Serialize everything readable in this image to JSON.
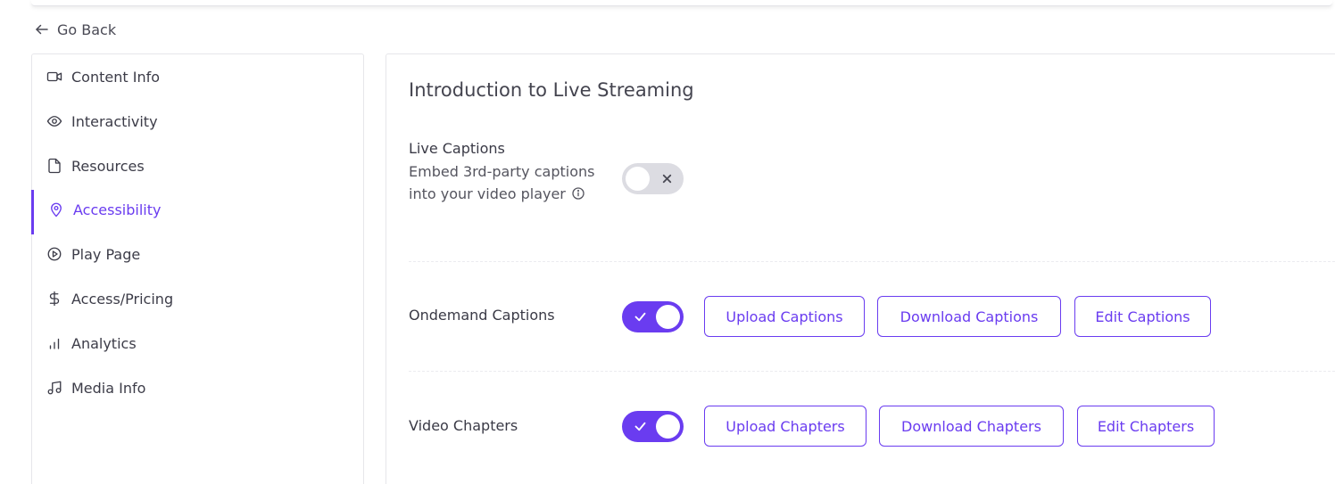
{
  "nav": {
    "go_back": "Go Back"
  },
  "sidebar": {
    "items": [
      {
        "label": "Content Info",
        "icon": "video-camera-icon"
      },
      {
        "label": "Interactivity",
        "icon": "eye-icon"
      },
      {
        "label": "Resources",
        "icon": "file-icon"
      },
      {
        "label": "Accessibility",
        "icon": "map-pin-icon",
        "active": true
      },
      {
        "label": "Play Page",
        "icon": "play-circle-icon"
      },
      {
        "label": "Access/Pricing",
        "icon": "dollar-icon"
      },
      {
        "label": "Analytics",
        "icon": "bar-chart-icon"
      },
      {
        "label": "Media Info",
        "icon": "music-icon"
      }
    ]
  },
  "main": {
    "title": "Introduction to Live Streaming",
    "live_captions": {
      "label": "Live Captions",
      "description": "Embed 3rd-party captions into your video player",
      "enabled": false
    },
    "ondemand_captions": {
      "label": "Ondemand Captions",
      "enabled": true,
      "buttons": [
        "Upload Captions",
        "Download Captions",
        "Edit Captions"
      ]
    },
    "video_chapters": {
      "label": "Video Chapters",
      "enabled": true,
      "buttons": [
        "Upload Chapters",
        "Download Chapters",
        "Edit Chapters"
      ]
    }
  },
  "colors": {
    "accent": "#6a3cf0",
    "toggle_off": "#dcdce2",
    "text": "#3a3a46"
  }
}
